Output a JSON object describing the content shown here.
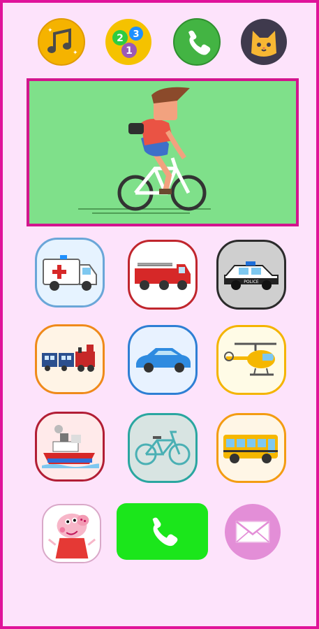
{
  "colors": {
    "frame_border": "#e0139a",
    "background": "#fde3fb",
    "video_border": "#d2158e",
    "video_bg": "#7fe08a",
    "call_green": "#1be61b",
    "mail_pink": "#e38ed7"
  },
  "top_buttons": [
    {
      "icon": "music-notes-icon"
    },
    {
      "icon": "numbers-icon",
      "digits": [
        "2",
        "3",
        "1"
      ]
    },
    {
      "icon": "phone-icon"
    },
    {
      "icon": "cat-icon"
    }
  ],
  "video": {
    "icon": "boy-cycling-animation"
  },
  "police_text": "POLICE",
  "vehicles": [
    {
      "name": "ambulance",
      "border": "#6aa6d8",
      "bg": "#e6f3ff"
    },
    {
      "name": "fire-truck",
      "border": "#c0262d",
      "bg": "#ffffff"
    },
    {
      "name": "police-car",
      "border": "#2b2b2b",
      "bg": "#cfcfcf"
    },
    {
      "name": "train",
      "border": "#ef8a1a",
      "bg": "#fff4e6"
    },
    {
      "name": "car",
      "border": "#2e7fd4",
      "bg": "#e8f2ff"
    },
    {
      "name": "helicopter",
      "border": "#f4b400",
      "bg": "#fffbe6"
    },
    {
      "name": "boat",
      "border": "#b21e35",
      "bg": "#ffeaea"
    },
    {
      "name": "bicycle",
      "border": "#2aa6a0",
      "bg": "#d8e4e2"
    },
    {
      "name": "school-bus",
      "border": "#f39c12",
      "bg": "#fff6e6"
    }
  ],
  "bottom": {
    "peppa_icon": "peppa-pig-icon",
    "call_icon": "phone-icon",
    "mail_icon": "envelope-icon"
  }
}
